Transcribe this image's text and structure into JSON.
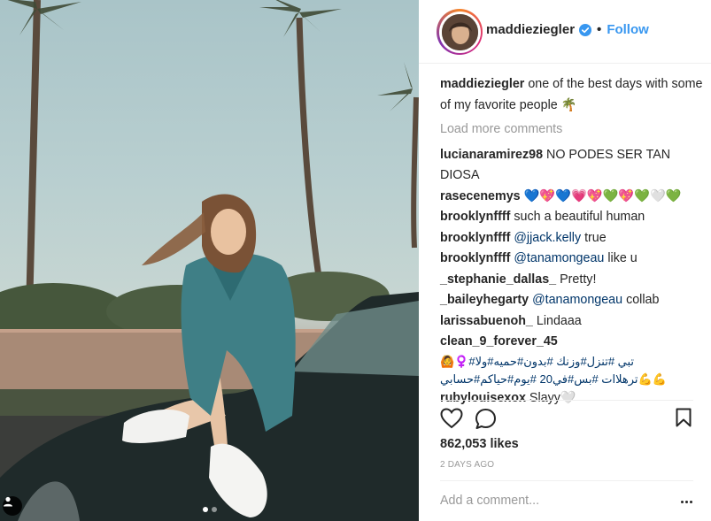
{
  "post": {
    "username": "maddieziegler",
    "follow_label": "Follow",
    "separator": "•",
    "caption_text": "one of the best days with some of my favorite people 🌴",
    "load_more_label": "Load more comments",
    "likes_text": "862,053 likes",
    "time_text": "2 DAYS AGO",
    "add_comment_placeholder": "Add a comment...",
    "carousel_pages": 2,
    "carousel_current": 1
  },
  "comments": [
    {
      "user": "lucianaramirez98",
      "text": "NO PODES SER TAN DIOSA"
    },
    {
      "user": "rasecenemys",
      "text": "💙💖💙💗💖💚💖💚🤍💚"
    },
    {
      "user": "brooklynffff",
      "text": "such a beautiful human"
    },
    {
      "user": "brooklynffff",
      "mention": "@jjack.kelly",
      "text": " true"
    },
    {
      "user": "brooklynffff",
      "mention": "@tanamongeau",
      "text": " like u"
    },
    {
      "user": "_stephanie_dallas_",
      "text": "Pretty!"
    },
    {
      "user": "_baileyhegarty",
      "mention": "@tanamongeau",
      "text": " collab"
    },
    {
      "user": "larissabuenoh_",
      "text": "Lindaaa"
    },
    {
      "user": "rubylouisexox",
      "text": "Slayy🤍"
    }
  ],
  "arabic_comment": {
    "user": "clean_9_forever_45",
    "line1": "تبي #تنزل#وزنك #بدون#حميه#ولا#♀️🙆",
    "line2": "💪💪ترهلاات #بس#في20 #يوم#حياكم#حسابي"
  },
  "colors": {
    "accent": "#3897f0",
    "mention": "#003569",
    "muted": "#999999",
    "text": "#262626"
  },
  "icons": [
    "verified-badge-icon",
    "heart-icon",
    "comment-icon",
    "bookmark-icon",
    "tag-person-icon",
    "more-options-icon"
  ]
}
